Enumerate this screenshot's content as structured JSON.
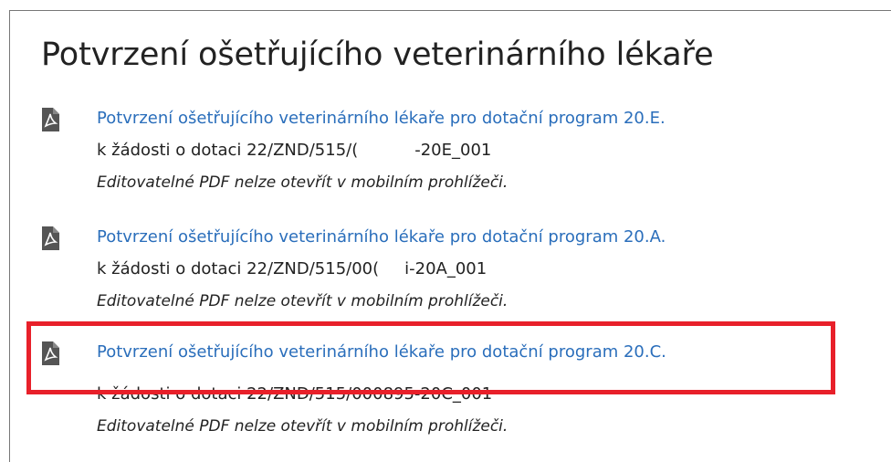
{
  "page": {
    "title": "Potvrzení ošetřujícího veterinárního lékaře"
  },
  "documents": [
    {
      "icon": "pdf-icon",
      "link": "Potvrzení ošetřujícího veterinárního lékaře pro dotační program 20.E.",
      "sub_prefix": "k žádosti o dotaci 22/ZND/515/(",
      "sub_suffix": "-20E_001",
      "note": "Editovatelné PDF nelze otevřít v mobilním prohlížeči."
    },
    {
      "icon": "pdf-icon",
      "link": "Potvrzení ošetřujícího veterinárního lékaře pro dotační program 20.A.",
      "sub_prefix": "k žádosti o dotaci 22/ZND/515/00(",
      "sub_suffix": "i-20A_001",
      "note": "Editovatelné PDF nelze otevřít v mobilním prohlížeči."
    },
    {
      "icon": "pdf-icon",
      "link": "Potvrzení ošetřujícího veterinárního lékaře pro dotační program 20.C.",
      "sub_prefix": "k žádosti o dotaci 22/ZND/515/000895-20C_001",
      "sub_suffix": "",
      "note": "Editovatelné PDF nelze otevřít v mobilním prohlížeči."
    }
  ],
  "colors": {
    "link": "#2a6ebb",
    "highlight": "#e8202a",
    "icon": "#555555"
  }
}
